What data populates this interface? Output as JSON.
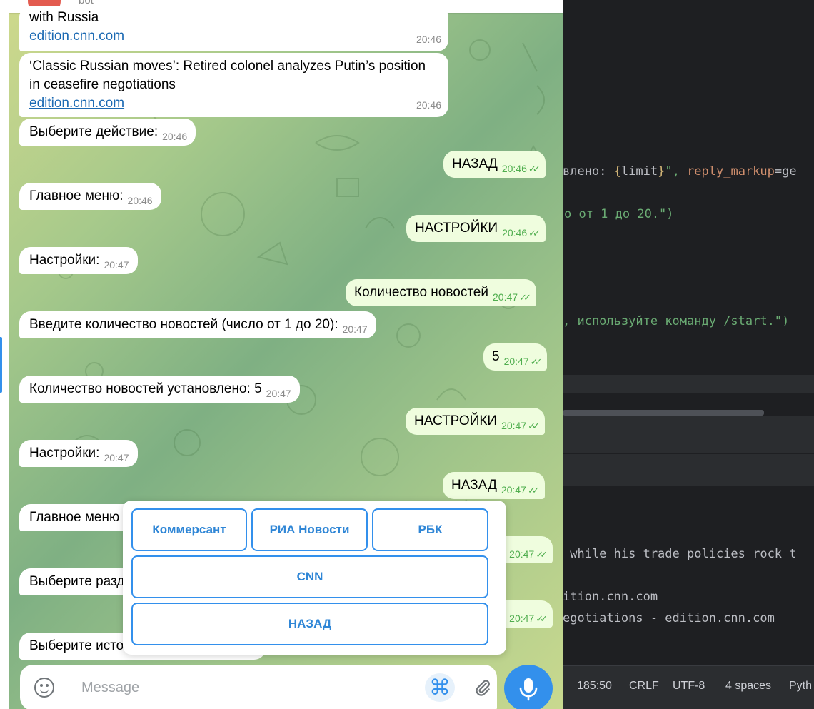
{
  "ide": {
    "code": [
      {
        "pre": "",
        "text1": "влено: ",
        "brace_open": "{",
        "var": "limit",
        "brace_close": "}",
        "text2": "\", ",
        "kw": "reply_markup",
        "text3": "=ge"
      },
      {
        "str": "о от 1 до 20.\")"
      },
      {
        "str": ", используйте команду /start.\")"
      }
    ],
    "console": [
      " while his trade policies rock t",
      "ition.cnn.com",
      "egotiations - edition.cnn.com"
    ],
    "status": {
      "position": "185:50",
      "line_ending": "CRLF",
      "encoding": "UTF-8",
      "indent": "4 spaces",
      "language": "Pyth"
    }
  },
  "chat": {
    "header_subtitle": "bot",
    "messages": [
      {
        "id": "m1",
        "dir": "in",
        "text": "with Russia",
        "link": "edition.cnn.com",
        "time": "20:46"
      },
      {
        "id": "m2",
        "dir": "in",
        "text": "‘Classic Russian moves’: Retired colonel analyzes Putin’s position in ceasefire negotiations",
        "link": "edition.cnn.com",
        "time": "20:46"
      },
      {
        "id": "m3",
        "dir": "in",
        "text": "Выберите действие:",
        "time": "20:46"
      },
      {
        "id": "m4",
        "dir": "out",
        "text": "НАЗАД",
        "time": "20:46"
      },
      {
        "id": "m5",
        "dir": "in",
        "text": "Главное меню:",
        "time": "20:46"
      },
      {
        "id": "m6",
        "dir": "out",
        "text": "НАСТРОЙКИ",
        "time": "20:46"
      },
      {
        "id": "m7",
        "dir": "in",
        "text": "Настройки:",
        "time": "20:47"
      },
      {
        "id": "m8",
        "dir": "out",
        "text": "Количество новостей",
        "time": "20:47"
      },
      {
        "id": "m9",
        "dir": "in",
        "text": "Введите количество новостей (число от 1 до 20):",
        "time": "20:47"
      },
      {
        "id": "m10",
        "dir": "out",
        "text": "5",
        "time": "20:47"
      },
      {
        "id": "m11",
        "dir": "in",
        "text": "Количество новостей установлено: 5",
        "time": "20:47"
      },
      {
        "id": "m12",
        "dir": "out",
        "text": "НАСТРОЙКИ",
        "time": "20:47"
      },
      {
        "id": "m13",
        "dir": "in",
        "text": "Настройки:",
        "time": "20:47"
      },
      {
        "id": "m14",
        "dir": "out",
        "text": "НАЗАД",
        "time": "20:47"
      },
      {
        "id": "m15",
        "dir": "in",
        "text": "Главное меню",
        "time": ""
      },
      {
        "id": "m16",
        "dir": "out",
        "text": "",
        "time": "20:47"
      },
      {
        "id": "m17",
        "dir": "in",
        "text": "Выберите разд",
        "time": ""
      },
      {
        "id": "m18",
        "dir": "out",
        "text": "",
        "time": "20:47"
      },
      {
        "id": "m19",
        "dir": "in",
        "text": "Выберите исто",
        "time": ""
      }
    ]
  },
  "keyboard": {
    "buttons": [
      "Коммерсант",
      "РИА Новости",
      "РБК",
      "CNN",
      "НАЗАД"
    ]
  },
  "composer": {
    "placeholder": "Message",
    "emoji_icon": "smile-icon",
    "commands_icon": "command-icon",
    "attach_icon": "paperclip-icon",
    "mic_icon": "microphone-icon"
  },
  "colors": {
    "accent": "#3390ec",
    "outgoing_bubble": "#effdde",
    "incoming_bubble": "#ffffff",
    "read_ticks": "#4fae4e",
    "ide_bg": "#1e1f22"
  }
}
